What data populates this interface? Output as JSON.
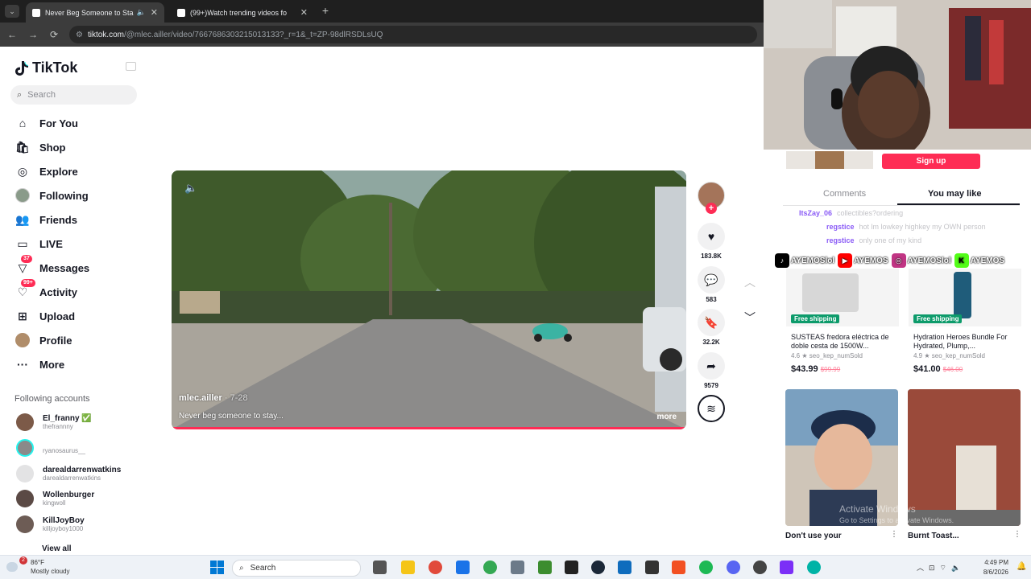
{
  "browser": {
    "tabs": [
      {
        "title": "Never Beg Someone to Sta",
        "active": true
      },
      {
        "title": "(99+)Watch trending videos fo",
        "active": false
      }
    ],
    "url_host": "tiktok.com",
    "url_path": "/@mlec.ailler/video/7667686303215013133?_r=1&_t=ZP-98dlRSDLsUQ"
  },
  "sidebar": {
    "logo_text": "TikTok",
    "search_placeholder": "Search",
    "nav": [
      {
        "label": "For You",
        "icon": "home-icon"
      },
      {
        "label": "Shop",
        "icon": "shop-icon"
      },
      {
        "label": "Explore",
        "icon": "compass-icon"
      },
      {
        "label": "Following",
        "icon": "following-icon"
      },
      {
        "label": "Friends",
        "icon": "friends-icon"
      },
      {
        "label": "LIVE",
        "icon": "live-icon"
      },
      {
        "label": "Messages",
        "icon": "messages-icon",
        "badge": "37"
      },
      {
        "label": "Activity",
        "icon": "activity-icon",
        "badge": "99+"
      },
      {
        "label": "Upload",
        "icon": "upload-icon"
      },
      {
        "label": "Profile",
        "icon": "profile-icon"
      },
      {
        "label": "More",
        "icon": "more-icon"
      }
    ],
    "following_title": "Following accounts",
    "accounts": [
      {
        "name": "El_franny ✅",
        "user": "thefrannny"
      },
      {
        "name": "",
        "user": "ryanosaurus__"
      },
      {
        "name": "darealdarrenwatkins",
        "user": "darealdarrenwatkins"
      },
      {
        "name": "Wollenburger",
        "user": "kingwoll"
      },
      {
        "name": "KillJoyBoy",
        "user": "killjoyboy1000"
      }
    ],
    "view_all": "View all"
  },
  "video": {
    "author": "mlec.ailler",
    "date": " · 7-28",
    "description": "Never beg someone to stay...",
    "more": "more",
    "progress": 1.0
  },
  "actions": {
    "likes": "183.8K",
    "comments": "583",
    "saves": "32.2K",
    "shares": "9579"
  },
  "right_panel": {
    "signup": "Sign up",
    "tabs": [
      "Comments",
      "You may like"
    ],
    "chat": [
      {
        "user": "ItsZay_06",
        "text": "collectibles?ordering"
      },
      {
        "user": "regstice",
        "text": "hot lm lowkey highkey my OWN person"
      },
      {
        "user": "regstice",
        "text": "only one of my kind"
      }
    ],
    "socials": [
      {
        "label": "AYEMOSlol",
        "icon": "tiktok-icon",
        "color": "#000000"
      },
      {
        "label": "AYEMOS",
        "icon": "youtube-icon",
        "color": "#ff0000"
      },
      {
        "label": "AYEMOSlol",
        "icon": "instagram-icon",
        "color": "#c13584"
      },
      {
        "label": "AYEMOS",
        "icon": "kick-icon",
        "color": "#53fc18"
      }
    ],
    "products": [
      {
        "ship": "Free shipping",
        "title": "SUSTEAS fredora eléctrica de doble cesta de 1500W...",
        "rating": "4.6 ★  seo_kep_numSold",
        "price": "$43.99",
        "old": "$99.99"
      },
      {
        "ship": "Free shipping",
        "title": "Hydration Heroes Bundle For Hydrated, Plump,...",
        "rating": "4.9 ★  seo_kep_numSold",
        "price": "$41.00",
        "old": "$46.00"
      }
    ],
    "videos": [
      {
        "caption": "Don't use your"
      },
      {
        "caption": "Burnt Toast..."
      }
    ],
    "watermark": "Activate Windows",
    "watermark_sub": "Go to Settings to activate Windows."
  },
  "taskbar": {
    "temp": "86°F",
    "weather": "Mostly cloudy",
    "search": "Search",
    "time": "4:49 PM",
    "date": "8/6/2026"
  }
}
